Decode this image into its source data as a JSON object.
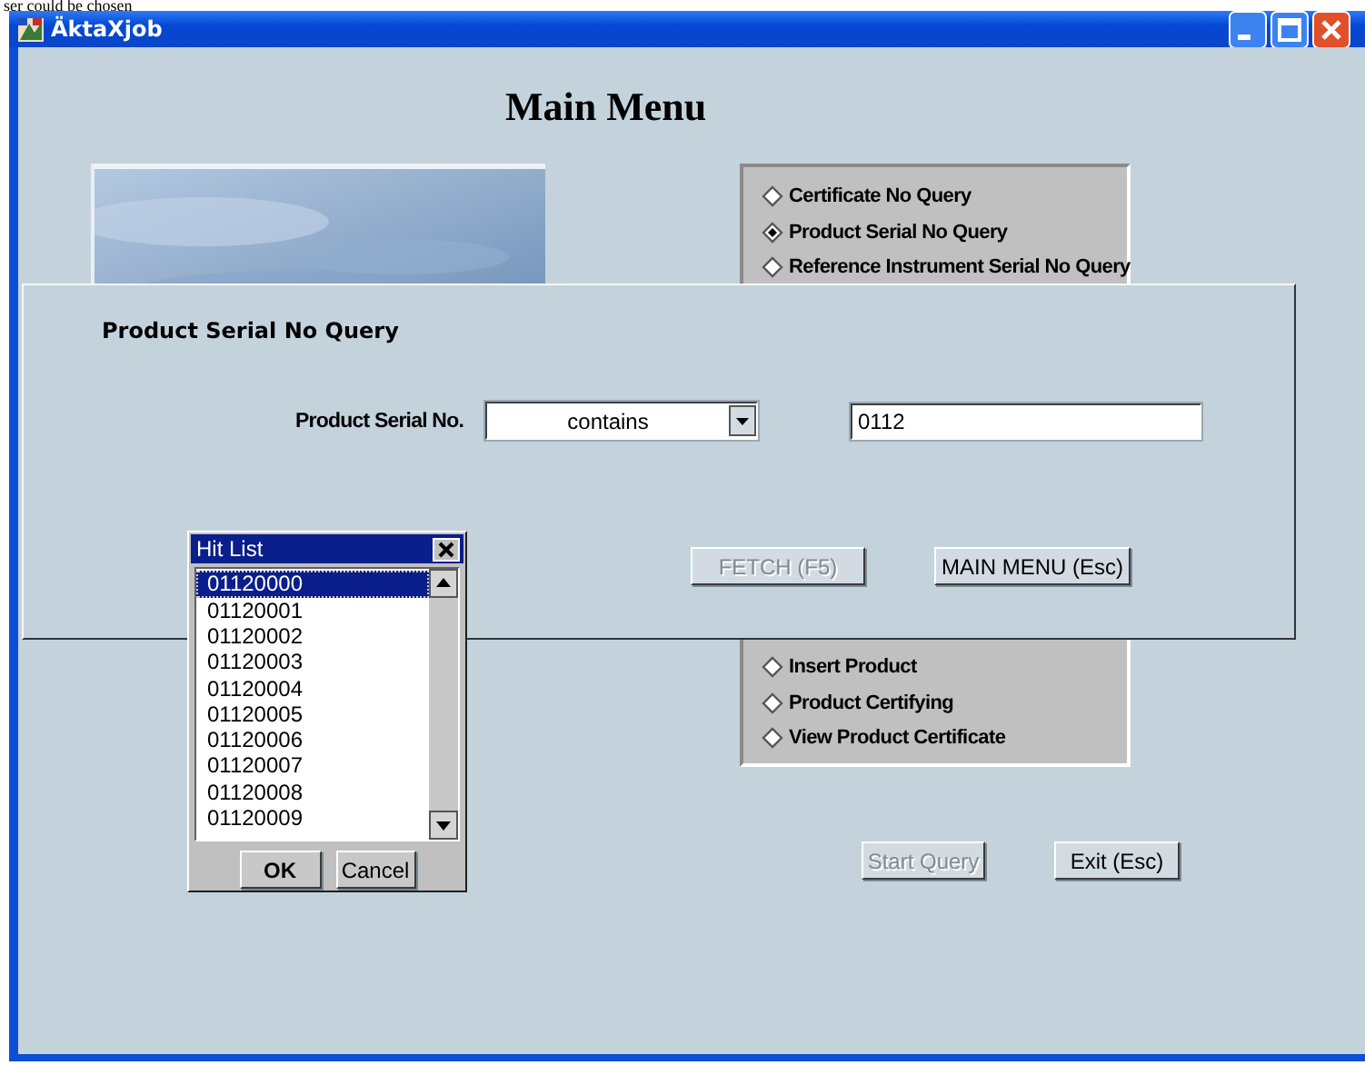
{
  "caption": "ser could be chosen",
  "window": {
    "title": "ÄktaXjob"
  },
  "main_menu": {
    "title": "Main Menu",
    "items": [
      {
        "label": "Certificate No Query",
        "selected": false
      },
      {
        "label": "Product Serial No Query",
        "selected": true
      },
      {
        "label": "Reference Instrument Serial No Query",
        "selected": false
      },
      {
        "label": "Insert Product",
        "selected": false
      },
      {
        "label": "Product Certifying",
        "selected": false
      },
      {
        "label": "View Product Certificate",
        "selected": false
      }
    ],
    "buttons": [
      {
        "label": "Start Query",
        "disabled": true
      },
      {
        "label": "Exit (Esc)",
        "disabled": false
      }
    ]
  },
  "query_dialog": {
    "title": "Product Serial No Query",
    "field_label": "Product Serial No.",
    "operator": "contains",
    "value": "0112",
    "buttons": [
      {
        "label": "FETCH (F5)",
        "disabled": true
      },
      {
        "label": "MAIN MENU (Esc)",
        "disabled": false
      }
    ]
  },
  "hit_list": {
    "title": "Hit List",
    "items": [
      {
        "label": "01120000",
        "selected": true
      },
      {
        "label": "01120001",
        "selected": false
      },
      {
        "label": "01120002",
        "selected": false
      },
      {
        "label": "01120003",
        "selected": false
      },
      {
        "label": "01120004",
        "selected": false
      },
      {
        "label": "01120005",
        "selected": false
      },
      {
        "label": "01120006",
        "selected": false
      },
      {
        "label": "01120007",
        "selected": false
      },
      {
        "label": "01120008",
        "selected": false
      },
      {
        "label": "01120009",
        "selected": false
      }
    ],
    "buttons": [
      {
        "label": "OK",
        "default": true
      },
      {
        "label": "Cancel",
        "default": false
      }
    ]
  }
}
